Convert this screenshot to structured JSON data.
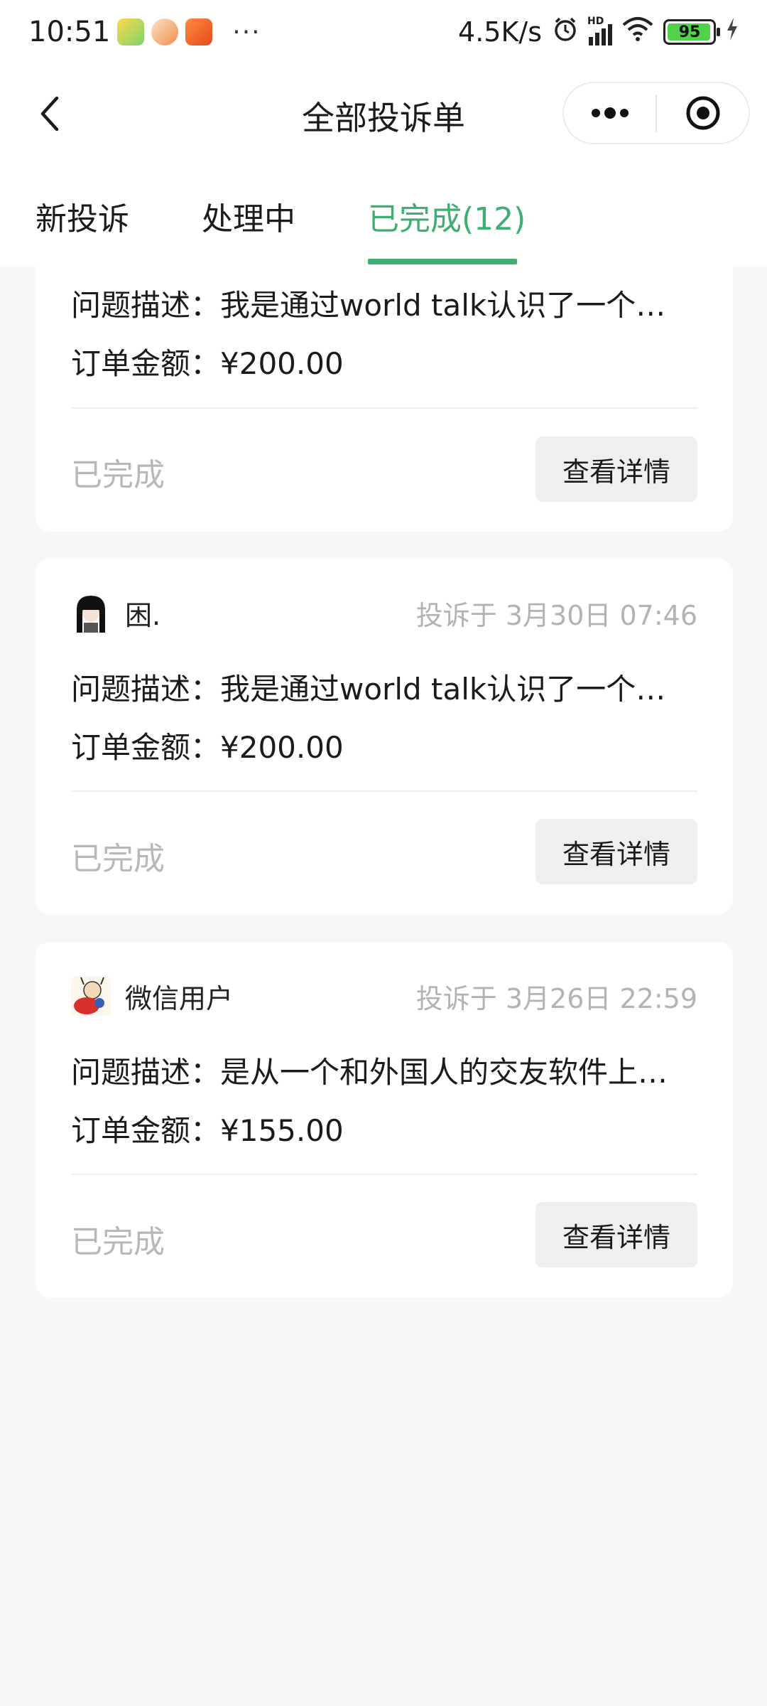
{
  "status_bar": {
    "time": "10:51",
    "more": "···",
    "net_speed": "4.5K/s",
    "hd": "HD",
    "battery": "95"
  },
  "nav": {
    "title": "全部投诉单"
  },
  "tabs": [
    {
      "label": "新投诉"
    },
    {
      "label": "处理中"
    },
    {
      "label": "已完成(12)"
    }
  ],
  "accent_color": "#3fae73",
  "cards": [
    {
      "user": "",
      "time": "",
      "desc": "问题描述：我是通过world talk认识了一个…",
      "amount": "订单金额：¥200.00",
      "status": "已完成",
      "button": "查看详情"
    },
    {
      "user": "困.",
      "avatar_icon": "girl-avatar-icon",
      "time": "投诉于 3月30日 07:46",
      "desc": "问题描述：我是通过world talk认识了一个…",
      "amount": "订单金额：¥200.00",
      "status": "已完成",
      "button": "查看详情"
    },
    {
      "user": "微信用户",
      "avatar_icon": "cartoon-avatar-icon",
      "time": "投诉于 3月26日 22:59",
      "desc": "问题描述：是从一个和外国人的交友软件上…",
      "amount": "订单金额：¥155.00",
      "status": "已完成",
      "button": "查看详情"
    }
  ]
}
